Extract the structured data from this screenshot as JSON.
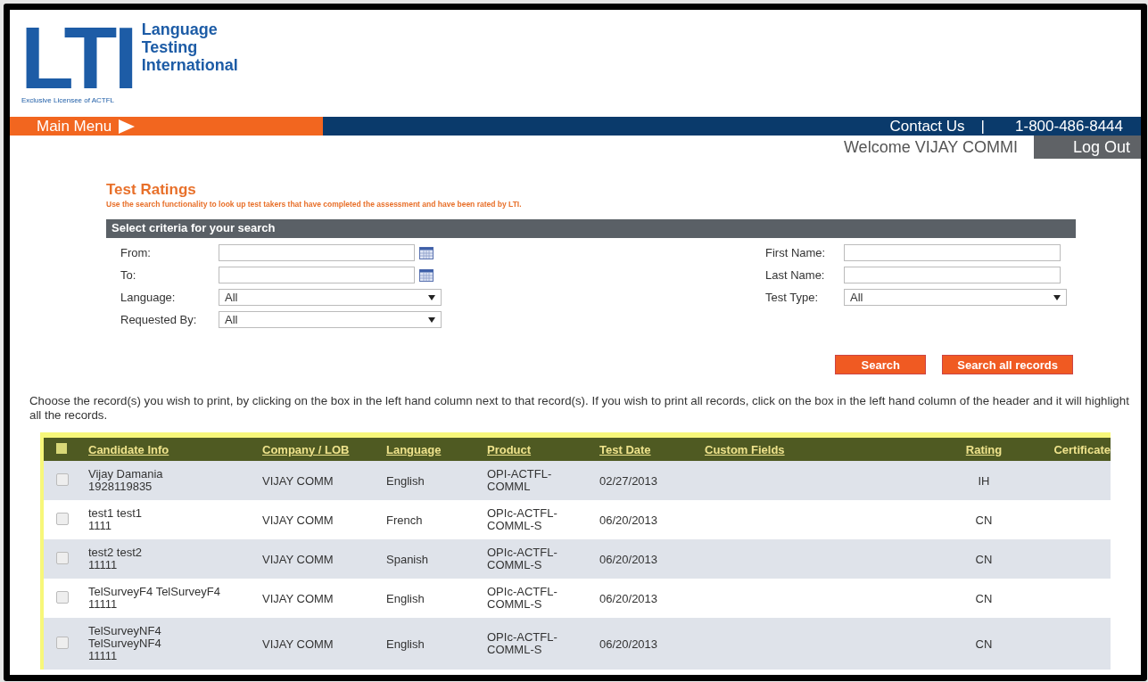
{
  "logo": {
    "letters": "LTI",
    "name_lines": [
      "Language",
      "Testing",
      "International"
    ],
    "tagline": "Exclusive Licensee of ACTFL"
  },
  "nav": {
    "main_menu": "Main Menu",
    "contact": "Contact Us",
    "separator": "|",
    "phone": "1-800-486-8444"
  },
  "user": {
    "welcome": "Welcome VIJAY COMMI",
    "logout": "Log Out"
  },
  "page": {
    "title": "Test Ratings",
    "subtitle": "Use the search functionality to look up test takers that have completed the assessment and have been rated by LTI."
  },
  "criteria": {
    "heading": "Select criteria for your search",
    "left_fields": [
      {
        "label": "From:",
        "kind": "date"
      },
      {
        "label": "To:",
        "kind": "date"
      },
      {
        "label": "Language:",
        "kind": "select",
        "value": "All"
      },
      {
        "label": "Requested By:",
        "kind": "select",
        "value": "All"
      }
    ],
    "right_fields": [
      {
        "label": "First Name:",
        "kind": "text"
      },
      {
        "label": "Last Name:",
        "kind": "text"
      },
      {
        "label": "Test Type:",
        "kind": "select",
        "value": "All"
      }
    ],
    "buttons": [
      "Search",
      "Search all records"
    ]
  },
  "instructions": "Choose the record(s) you wish to print, by clicking on the box in the left hand column next to that record(s). If you wish to print all records, click on the box in the left hand column of the header and it will highlight all the records.",
  "table": {
    "columns": [
      "Candidate Info",
      "Company / LOB",
      "Language",
      "Product",
      "Test Date",
      "Custom Fields",
      "Rating",
      "Certificate"
    ],
    "select_all": {
      "checked": false
    },
    "rows": [
      {
        "checked": false,
        "candidate_name": "Vijay Damania",
        "candidate_id": "1928119835",
        "company": "VIJAY COMM",
        "language": "English",
        "product": "OPI-ACTFL-COMML",
        "test_date": "02/27/2013",
        "rating": "IH"
      },
      {
        "checked": false,
        "candidate_name": "test1 test1",
        "candidate_id": "1111",
        "company": "VIJAY COMM",
        "language": "French",
        "product": "OPIc-ACTFL-COMML-S",
        "test_date": "06/20/2013",
        "rating": "CN"
      },
      {
        "checked": false,
        "candidate_name": "test2 test2",
        "candidate_id": "11111",
        "company": "VIJAY COMM",
        "language": "Spanish",
        "product": "OPIc-ACTFL-COMML-S",
        "test_date": "06/20/2013",
        "rating": "CN"
      },
      {
        "checked": false,
        "candidate_name": "TelSurveyF4 TelSurveyF4",
        "candidate_id": "11111",
        "company": "VIJAY COMM",
        "language": "English",
        "product": "OPIc-ACTFL-COMML-S",
        "test_date": "06/20/2013",
        "rating": "CN"
      },
      {
        "checked": false,
        "candidate_name": "TelSurveyNF4 TelSurveyNF4",
        "candidate_id": "11111",
        "company": "VIJAY COMM",
        "language": "English",
        "product": "OPIc-ACTFL-COMML-S",
        "test_date": "06/20/2013",
        "rating": "CN"
      }
    ]
  }
}
